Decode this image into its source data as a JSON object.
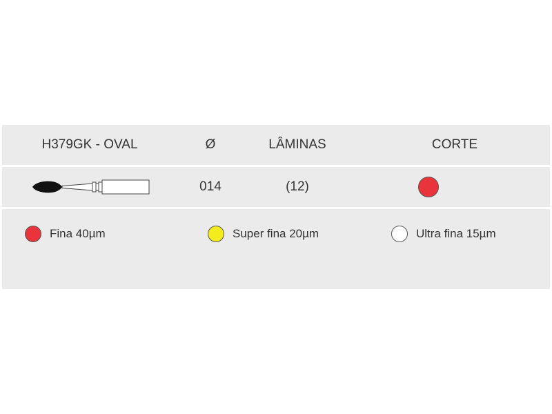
{
  "header": {
    "model": "H379GK - OVAL",
    "diameter": "Ø",
    "blades": "LÂMINAS",
    "cut": "CORTE"
  },
  "product": {
    "icon": "oval-bur-icon",
    "diameter": "014",
    "blades": "(12)",
    "cut_color": "#e8343a"
  },
  "legend": [
    {
      "label": "Fina 40µm",
      "color": "#e8343a"
    },
    {
      "label": "Super fina 20µm",
      "color": "#f5ec1e"
    },
    {
      "label": "Ultra fina 15µm",
      "color": "#ffffff"
    }
  ]
}
